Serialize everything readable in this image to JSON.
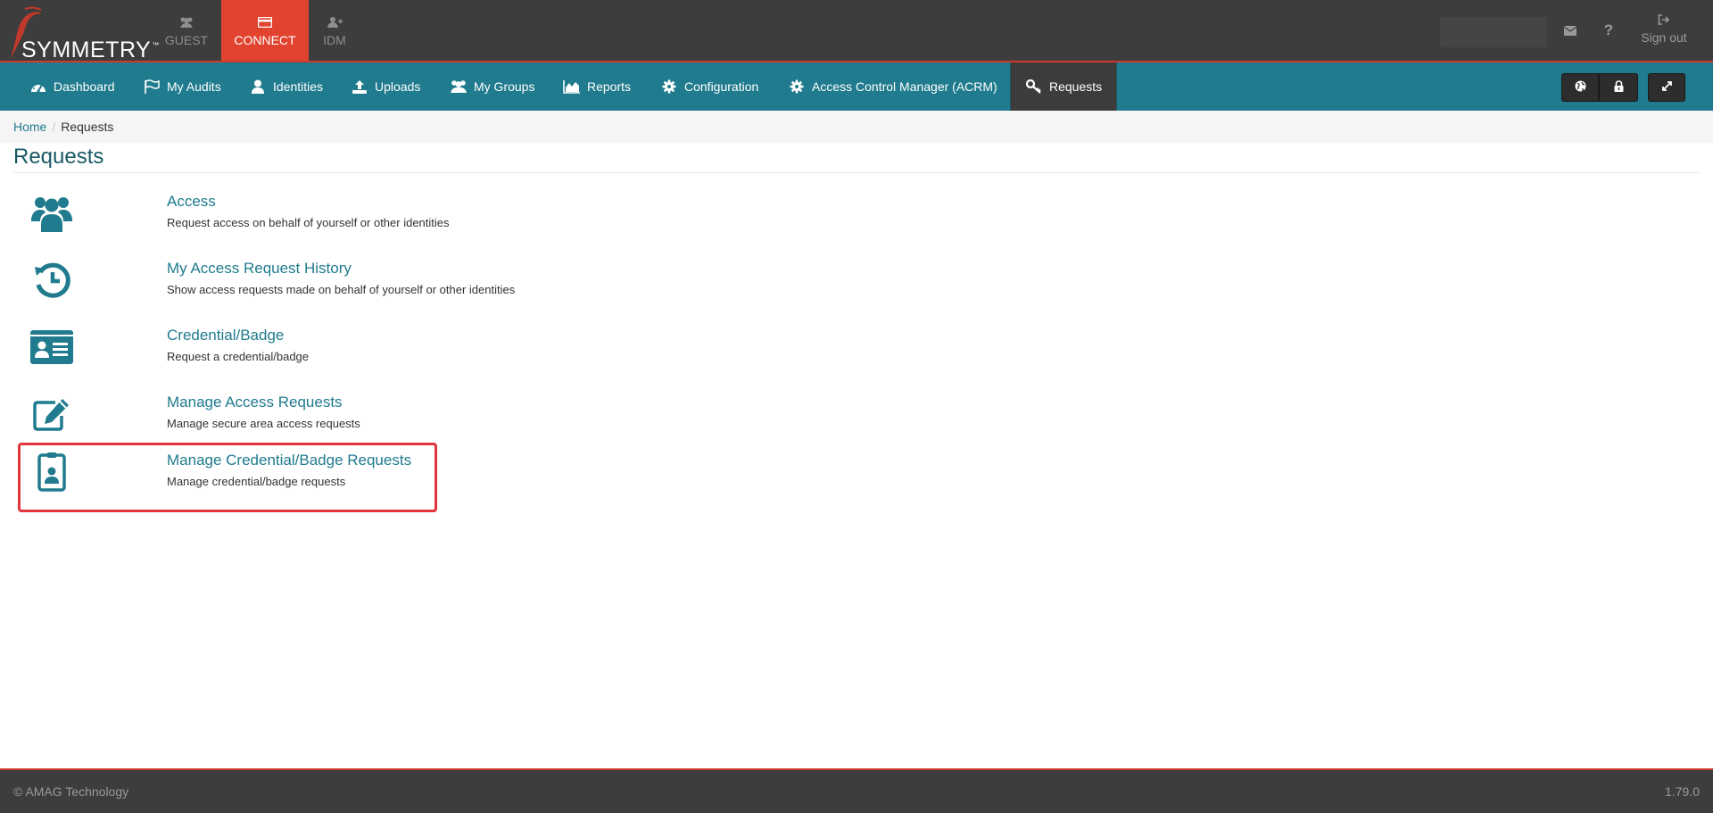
{
  "brand": {
    "name": "SYMMETRY",
    "tm": "™"
  },
  "app_tabs": [
    {
      "label": "GUEST",
      "icon": "users-icon",
      "active": false
    },
    {
      "label": "CONNECT",
      "icon": "card-icon",
      "active": true
    },
    {
      "label": "IDM",
      "icon": "user-plus-icon",
      "active": false
    }
  ],
  "header": {
    "help_label": "?",
    "signout_label": "Sign out"
  },
  "nav": [
    {
      "label": "Dashboard",
      "icon": "dashboard-icon"
    },
    {
      "label": "My Audits",
      "icon": "flag-icon"
    },
    {
      "label": "Identities",
      "icon": "user-icon"
    },
    {
      "label": "Uploads",
      "icon": "upload-icon"
    },
    {
      "label": "My Groups",
      "icon": "users-icon"
    },
    {
      "label": "Reports",
      "icon": "area-chart-icon"
    },
    {
      "label": "Configuration",
      "icon": "gear-icon"
    },
    {
      "label": "Access Control Manager (ACRM)",
      "icon": "gear-icon"
    },
    {
      "label": "Requests",
      "icon": "key-icon",
      "active": true
    }
  ],
  "breadcrumb": {
    "home": "Home",
    "separator": "/",
    "current": "Requests"
  },
  "page": {
    "title": "Requests"
  },
  "requests": [
    {
      "title": "Access",
      "description": "Request access on behalf of yourself or other identities",
      "icon": "users-icon"
    },
    {
      "title": "My Access Request History",
      "description": "Show access requests made on behalf of yourself or other identities",
      "icon": "history-icon"
    },
    {
      "title": "Credential/Badge",
      "description": "Request a credential/badge",
      "icon": "id-card-icon"
    },
    {
      "title": "Manage Access Requests",
      "description": "Manage secure area access requests",
      "icon": "edit-icon"
    },
    {
      "title": "Manage Credential/Badge Requests",
      "description": "Manage credential/badge requests",
      "icon": "id-badge-icon",
      "highlighted": true
    }
  ],
  "footer": {
    "copyright": "© AMAG Technology",
    "version": "1.79.0"
  },
  "colors": {
    "teal": "#1f7b8d",
    "red": "#e1432f",
    "dark": "#3d3d3d",
    "highlight": "#e2353b"
  }
}
